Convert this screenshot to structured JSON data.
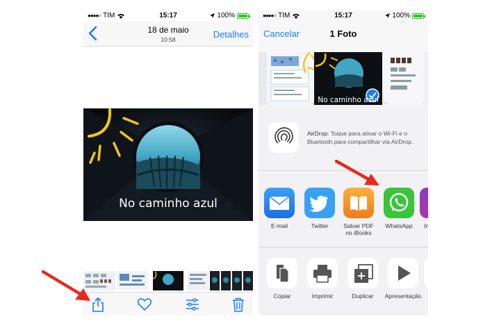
{
  "status": {
    "carrier": "TIM",
    "time": "15:17",
    "battery": "100%"
  },
  "left": {
    "nav": {
      "title": "18 de maio",
      "subtitle": "10:58",
      "details_label": "Detalhes"
    },
    "photo_caption": "No caminho azul"
  },
  "right": {
    "nav": {
      "cancel_label": "Cancelar",
      "title": "1 Foto"
    },
    "strip_caption": "No caminho azul",
    "airdrop": {
      "label": "AirDrop",
      "text": ": Toque para ativar o Wi-Fi e o Bluetooth para compartilhar via AirDrop."
    },
    "apps": [
      {
        "label": "E-mail",
        "icon": "mail-icon"
      },
      {
        "label": "Twitter",
        "icon": "twitter-icon"
      },
      {
        "label": "Salvar PDF no iBooks",
        "icon": "ibooks-icon"
      },
      {
        "label": "WhatsApp",
        "icon": "whatsapp-icon"
      },
      {
        "label": "In",
        "icon": "instagram-icon"
      }
    ],
    "actions": [
      {
        "label": "Copiar",
        "icon": "copy-icon"
      },
      {
        "label": "Imprimir",
        "icon": "print-icon"
      },
      {
        "label": "Duplicar",
        "icon": "duplicate-icon"
      },
      {
        "label": "Apresentação",
        "icon": "slideshow-icon"
      }
    ]
  },
  "colors": {
    "ios_blue": "#1a7cf2",
    "arrow_red": "#e8291c",
    "whatsapp_green": "#39c43a",
    "twitter_blue": "#38a1f3",
    "ibooks_orange": "#f5901e"
  }
}
